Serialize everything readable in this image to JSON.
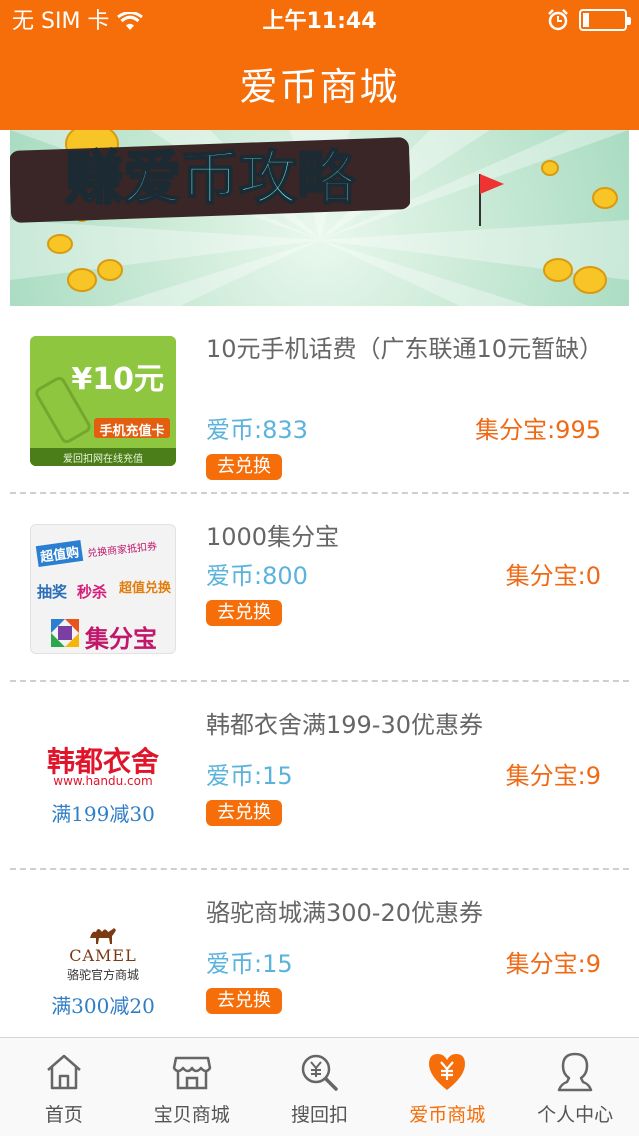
{
  "status_bar": {
    "carrier": "无 SIM 卡",
    "time": "上午11:44"
  },
  "nav": {
    "title": "爱币商城"
  },
  "banner": {
    "title": "赚爱币攻略"
  },
  "items": [
    {
      "name": "10元手机话费（广东联通10元暂缺）",
      "coins": "爱币:833",
      "points": "集分宝:995",
      "button": "去兑换",
      "thumb": {
        "price": "¥10元",
        "card_label": "手机充值卡",
        "footer": "爱回扣网在线充值"
      }
    },
    {
      "name": "1000集分宝",
      "coins": "爱币:800",
      "points": "集分宝:0",
      "button": "去兑换",
      "thumb": {
        "tag1": "超值购",
        "tag2": "兑换商家抵扣券",
        "tag3": "抽奖",
        "tag4": "秒杀",
        "tag5": "超值兑换",
        "brand": "集分宝"
      }
    },
    {
      "name": "韩都衣舍满199-30优惠券",
      "coins": "爱币:15",
      "points": "集分宝:9",
      "button": "去兑换",
      "thumb": {
        "brand": "韩都衣舍",
        "url": "www.handu.com",
        "deal": "满199减30"
      }
    },
    {
      "name": "骆驼商城满300-20优惠券",
      "coins": "爱币:15",
      "points": "集分宝:9",
      "button": "去兑换",
      "thumb": {
        "brand": "CAMEL",
        "store": "骆驼官方商城",
        "deal": "满300减20"
      }
    }
  ],
  "tabs": [
    {
      "label": "首页",
      "icon": "home-icon",
      "active": false
    },
    {
      "label": "宝贝商城",
      "icon": "store-icon",
      "active": false
    },
    {
      "label": "搜回扣",
      "icon": "search-yen-icon",
      "active": false
    },
    {
      "label": "爱币商城",
      "icon": "heart-yen-icon",
      "active": true
    },
    {
      "label": "个人中心",
      "icon": "user-icon",
      "active": false
    }
  ],
  "colors": {
    "primary": "#f56e0a",
    "coin_text": "#5ab3dc",
    "points_text": "#f06a16"
  }
}
